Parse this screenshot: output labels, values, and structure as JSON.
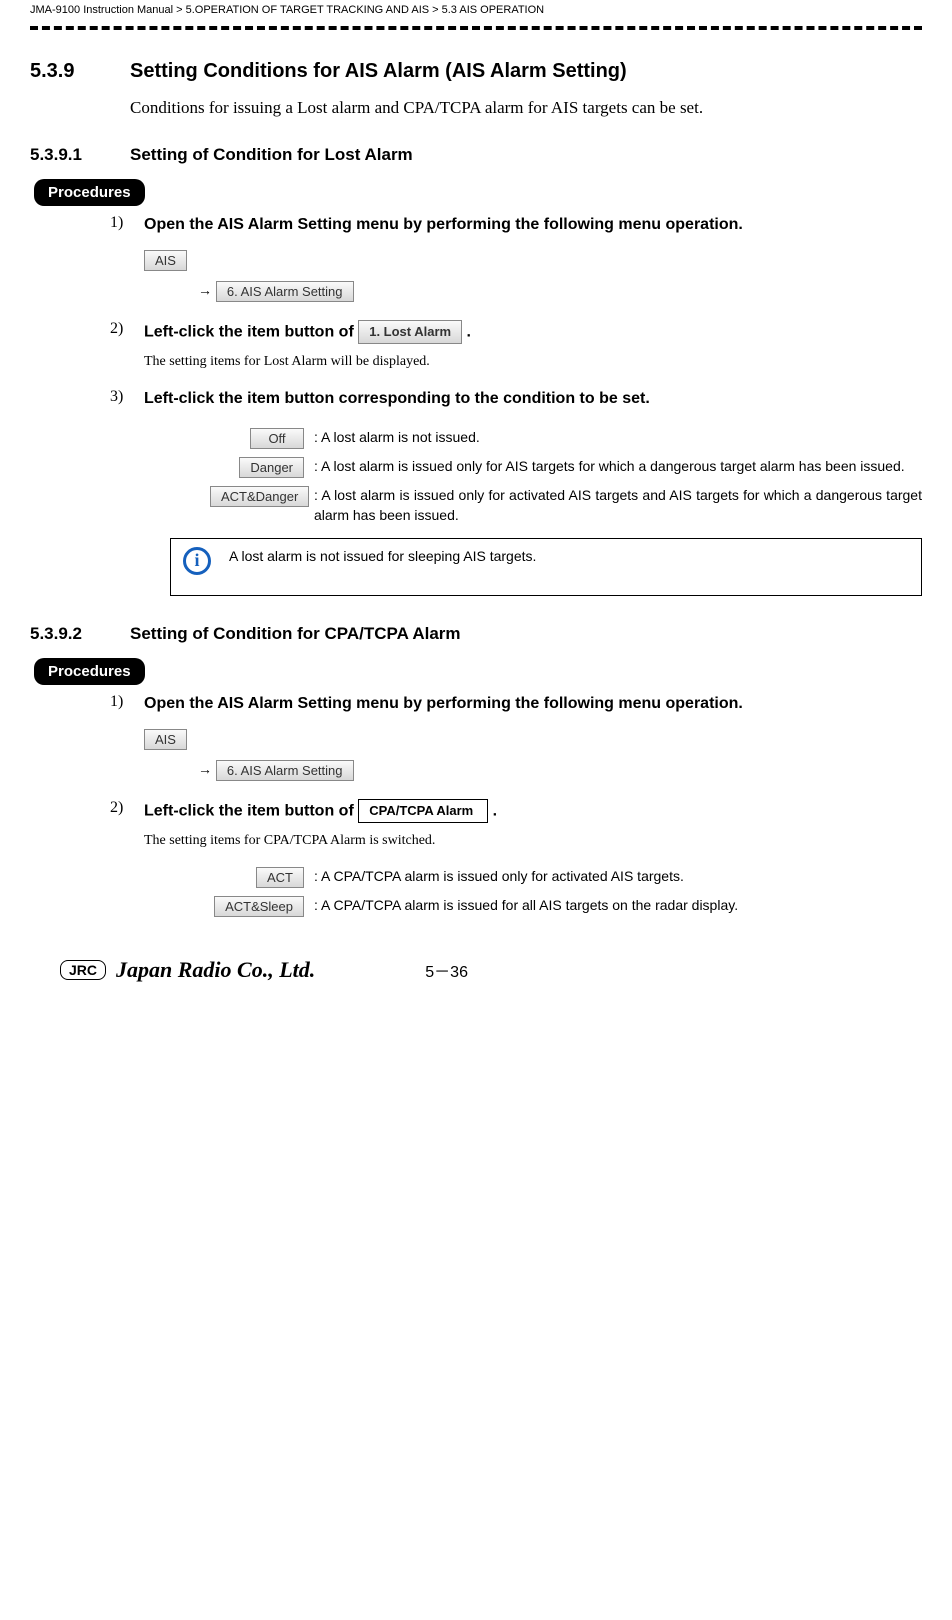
{
  "header": {
    "breadcrumb": "JMA-9100 Instruction Manual > 5.OPERATION OF TARGET TRACKING AND AIS > 5.3  AIS OPERATION"
  },
  "section539": {
    "number": "5.3.9",
    "title": "Setting Conditions for AIS Alarm (AIS Alarm Setting)",
    "body": "Conditions for issuing a Lost alarm and CPA/TCPA alarm for AIS targets can be set."
  },
  "section5391": {
    "number": "5.3.9.1",
    "title": "Setting of Condition for Lost Alarm",
    "procedures_label": "Procedures",
    "step1": {
      "num": "1)",
      "title": "Open the AIS Alarm Setting menu by performing the following menu operation.",
      "menu_ais": "AIS",
      "arrow": "→",
      "menu_setting": "6. AIS Alarm Setting"
    },
    "step2": {
      "num": "2)",
      "title_pre": "Left-click the item button of ",
      "btn": "1. Lost Alarm",
      "title_post": " .",
      "desc": "The setting items for Lost Alarm will be displayed."
    },
    "step3": {
      "num": "3)",
      "title": "Left-click the item button corresponding to the condition to be set.",
      "options": [
        {
          "btn": "Off",
          "desc": ": A lost alarm is not issued."
        },
        {
          "btn": "Danger",
          "desc": ": A lost alarm is issued only for AIS targets for which a dangerous target alarm has been issued."
        },
        {
          "btn": "ACT&Danger",
          "desc": ": A lost alarm is issued only for activated AIS targets and AIS targets for which a dangerous target alarm has been issued."
        }
      ],
      "info": "A lost alarm is not issued for sleeping AIS targets."
    }
  },
  "section5392": {
    "number": "5.3.9.2",
    "title": "Setting of Condition for CPA/TCPA Alarm",
    "procedures_label": "Procedures",
    "step1": {
      "num": "1)",
      "title": "Open the AIS Alarm Setting menu by performing the following menu operation.",
      "menu_ais": "AIS",
      "arrow": "→",
      "menu_setting": "6. AIS Alarm Setting"
    },
    "step2": {
      "num": "2)",
      "title_pre": "Left-click the item button of ",
      "btn": "CPA/TCPA Alarm",
      "title_post": ".",
      "desc": "The setting items for CPA/TCPA Alarm is switched.",
      "options": [
        {
          "btn": "ACT",
          "desc": ": A CPA/TCPA alarm is issued only for activated AIS targets."
        },
        {
          "btn": "ACT&Sleep",
          "desc": ": A CPA/TCPA alarm is issued for all AIS targets on the radar display."
        }
      ]
    }
  },
  "footer": {
    "jrc": "JRC",
    "company": "Japan Radio Co., Ltd.",
    "page": "5－36"
  }
}
